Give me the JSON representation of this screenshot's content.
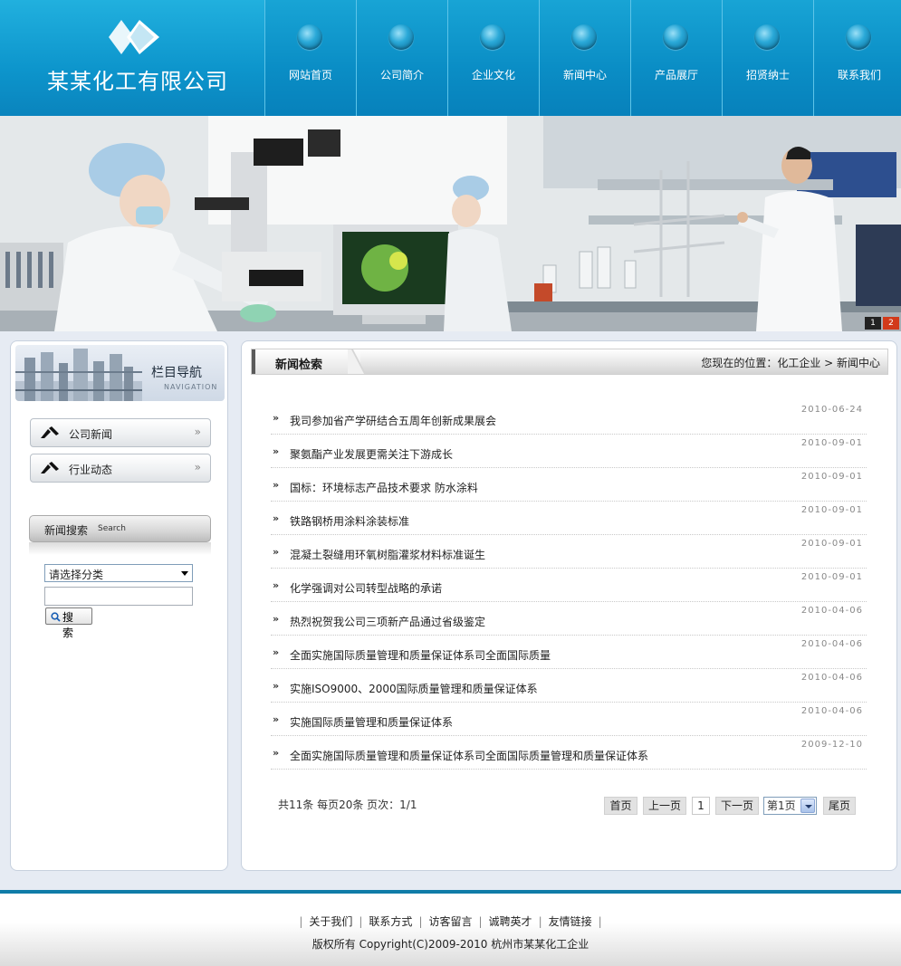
{
  "site": {
    "company_name": "某某化工有限公司"
  },
  "nav": {
    "items": [
      "网站首页",
      "公司简介",
      "企业文化",
      "新闻中心",
      "产品展厅",
      "招贤纳士",
      "联系我们"
    ]
  },
  "banner": {
    "slides": [
      "1",
      "2"
    ],
    "active_slide": "2"
  },
  "sidebar": {
    "header_title": "栏目导航",
    "header_sub": "NAVIGATION",
    "menu": [
      "公司新闻",
      "行业动态"
    ],
    "menu_arrow": "»",
    "search_title": "新闻搜索",
    "search_title_en": "Search",
    "category_select": "请选择分类",
    "keyword_value": "",
    "search_button": "搜 索"
  },
  "main": {
    "title": "新闻检索",
    "breadcrumb": "您现在的位置：化工企业 > 新闻中心",
    "bullet": "»",
    "news": [
      {
        "title": "我司参加省产学研结合五周年创新成果展会",
        "date": "2010-06-24"
      },
      {
        "title": "聚氨酯产业发展更需关注下游成长",
        "date": "2010-09-01"
      },
      {
        "title": "国标：环境标志产品技术要求 防水涂料",
        "date": "2010-09-01"
      },
      {
        "title": "铁路钢桥用涂料涂装标准",
        "date": "2010-09-01"
      },
      {
        "title": "混凝土裂缝用环氧树脂灌浆材料标准诞生",
        "date": "2010-09-01"
      },
      {
        "title": "化学强调对公司转型战略的承诺",
        "date": "2010-09-01"
      },
      {
        "title": "热烈祝贺我公司三项新产品通过省级鉴定",
        "date": "2010-04-06"
      },
      {
        "title": "全面实施国际质量管理和质量保证体系司全面国际质量",
        "date": "2010-04-06"
      },
      {
        "title": "实施ISO9000、2000国际质量管理和质量保证体系",
        "date": "2010-04-06"
      },
      {
        "title": "实施国际质量管理和质量保证体系",
        "date": "2010-04-06"
      },
      {
        "title": "全面实施国际质量管理和质量保证体系司全面国际质量管理和质量保证体系",
        "date": "2009-12-10"
      }
    ],
    "pager": {
      "info": "共11条  每页20条  页次：1/1",
      "first": "首页",
      "prev": "上一页",
      "current": "1",
      "next": "下一页",
      "select": "第1页",
      "last": "尾页"
    }
  },
  "footer": {
    "links": [
      "关于我们",
      "联系方式",
      "访客留言",
      "诚聘英才",
      "友情链接"
    ],
    "separator": "|",
    "copyright": "版权所有  Copyright(C)2009-2010 杭州市某某化工企业"
  },
  "colors": {
    "brand_blue": "#0a8cc4",
    "footer_line": "#0f7ca8",
    "banner_active_dot": "#d23a1a"
  }
}
